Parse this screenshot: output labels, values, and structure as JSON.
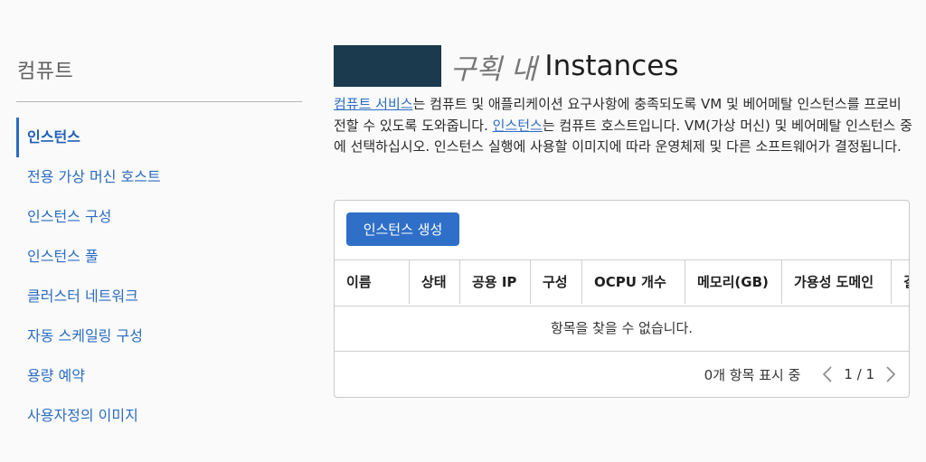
{
  "sidebar": {
    "title": "컴퓨트",
    "items": [
      {
        "label": "인스턴스",
        "active": true
      },
      {
        "label": "전용 가상 머신 호스트",
        "active": false
      },
      {
        "label": "인스턴스 구성",
        "active": false
      },
      {
        "label": "인스턴스 풀",
        "active": false
      },
      {
        "label": "클러스터 네트워크",
        "active": false
      },
      {
        "label": "자동 스케일링 구성",
        "active": false
      },
      {
        "label": "용량 예약",
        "active": false
      },
      {
        "label": "사용자정의 이미지",
        "active": false
      }
    ]
  },
  "header": {
    "compartment_suffix": "구획 내",
    "title": "Instances"
  },
  "description": {
    "link1": "컴퓨트 서비스",
    "text1": "는 컴퓨트 및 애플리케이션 요구사항에 충족되도록 VM 및 베어메탈 인스턴스를 프로비전할 수 있도록 도와줍니다. ",
    "link2": "인스턴스",
    "text2": "는 컴퓨트 호스트입니다. VM(가상 머신) 및 베어메탈 인스턴스 중에 선택하십시오. 인스턴스 실행에 사용할 이미지에 따라 운영체제 및 다른 소프트웨어가 결정됩니다."
  },
  "panel": {
    "create_button": "인스턴스 생성",
    "columns": [
      "이름",
      "상태",
      "공용 IP",
      "구성",
      "OCPU 개수",
      "메모리(GB)",
      "가용성 도메인",
      "결"
    ],
    "empty_message": "항목을 찾을 수 없습니다.",
    "footer": {
      "count_text": "0개 항목 표시 중",
      "page_text": "1 / 1"
    }
  },
  "colors": {
    "accent": "#2b6cc4",
    "button": "#2f6fc7",
    "redaction": "#1b3a4d"
  }
}
